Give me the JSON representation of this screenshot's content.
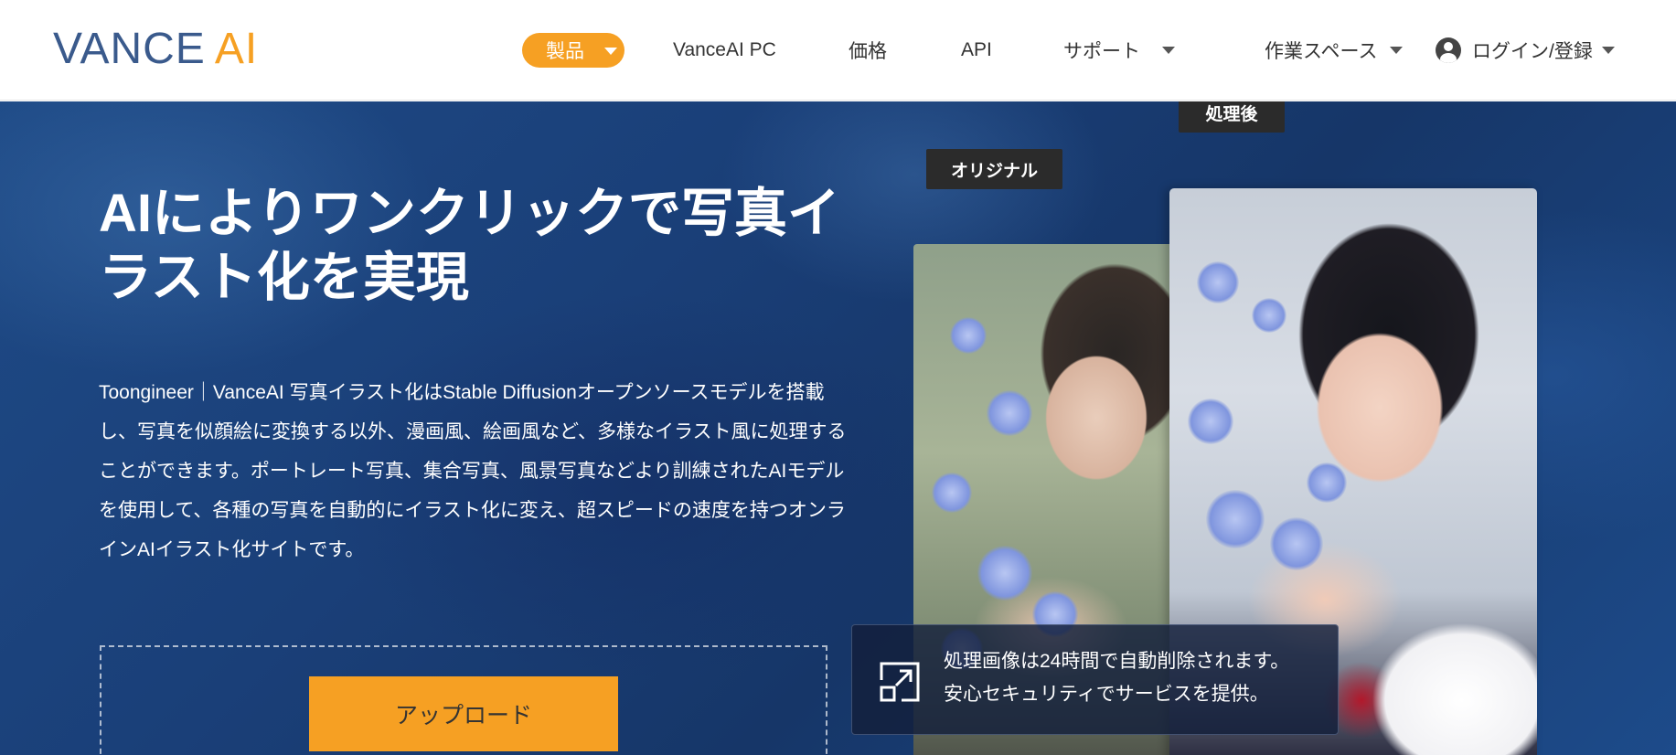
{
  "header": {
    "logo_vance": "VANCE",
    "logo_ai": "AI",
    "nav": {
      "products": "製品",
      "pc": "VanceAI PC",
      "price": "価格",
      "api": "API",
      "support": "サポート",
      "workspace": "作業スペース",
      "login": "ログイン/登録"
    }
  },
  "hero": {
    "title": "AIによりワンクリックで写真イラスト化を実現",
    "description": "Toongineer｜VanceAI 写真イラスト化はStable Diffusionオープンソースモデルを搭載し、写真を似顔絵に変換する以外、漫画風、絵画風など、多様なイラスト風に処理することができます。ポートレート写真、集合写真、風景写真などより訓練されたAIモデルを使用して、各種の写真を自動的にイラスト化に変え、超スピードの速度を持つオンラインAIイラスト化サイトです。",
    "upload_label": "アップロード"
  },
  "compare": {
    "original_label": "オリジナル",
    "processed_label": "処理後"
  },
  "notice": {
    "line1": "処理画像は24時間で自動削除されます。",
    "line2": "安心セキュリティでサービスを提供。"
  },
  "colors": {
    "accent": "#f6a023",
    "logo_blue": "#3a5a8c",
    "hero_bg": "#1a3f78"
  },
  "icons": {
    "user": "user-avatar-icon",
    "dropdown": "chevron-down-icon",
    "notice": "expand-square-icon"
  }
}
